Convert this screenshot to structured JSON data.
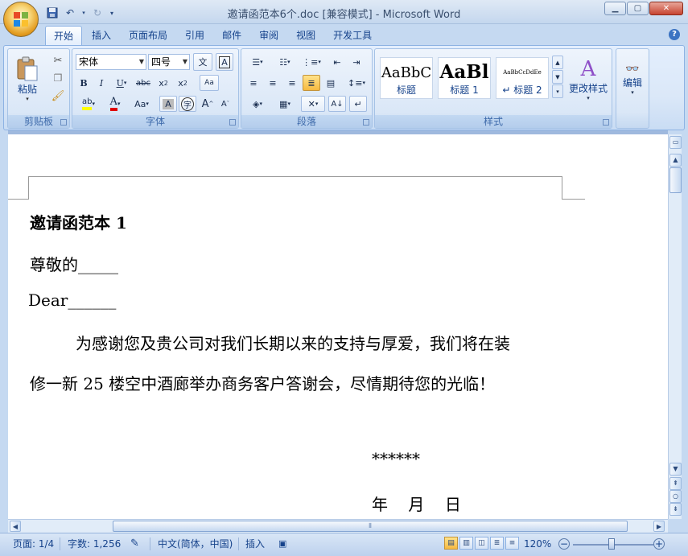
{
  "window": {
    "title": "邀请函范本6个.doc [兼容模式] - Microsoft Word"
  },
  "qat": {
    "icons": [
      "save-icon",
      "undo-icon",
      "redo-icon",
      "customize-icon"
    ]
  },
  "tabs": [
    {
      "label": "开始",
      "active": true
    },
    {
      "label": "插入",
      "active": false
    },
    {
      "label": "页面布局",
      "active": false
    },
    {
      "label": "引用",
      "active": false
    },
    {
      "label": "邮件",
      "active": false
    },
    {
      "label": "审阅",
      "active": false
    },
    {
      "label": "视图",
      "active": false
    },
    {
      "label": "开发工具",
      "active": false
    }
  ],
  "ribbon": {
    "clipboard": {
      "label": "剪贴板",
      "paste_label": "粘贴"
    },
    "font": {
      "label": "字体",
      "font_name": "宋体",
      "font_size": "四号"
    },
    "paragraph": {
      "label": "段落"
    },
    "styles": {
      "label": "样式",
      "cards": [
        {
          "sample": "AaBbC",
          "name": "标题"
        },
        {
          "sample": "AaBl",
          "name": "标题 1"
        },
        {
          "sample": "AaBbCcDdEe",
          "name": "↵ 标题 2"
        }
      ],
      "change_styles_label": "更改样式"
    },
    "editing": {
      "label": "编辑"
    }
  },
  "document": {
    "heading": "邀请函范本 1",
    "salutation_cn": "尊敬的_____",
    "salutation_en": "Dear______",
    "body_line1": "为感谢您及贵公司对我们长期以来的支持与厚爱，我们将在装",
    "body_line2": "修一新 25 楼空中酒廊举办商务客户答谢会，尽情期待您的光临！",
    "signature": "******",
    "date_line": "年    月    日"
  },
  "status": {
    "page": "页面: 1/4",
    "word_count": "字数: 1,256",
    "language": "中文(简体，中国)",
    "mode": "插入",
    "zoom": "120%"
  },
  "colors": {
    "accent": "#15428b",
    "ribbon_bg": "#dbe8f8",
    "frame": "#c5d9f1"
  }
}
